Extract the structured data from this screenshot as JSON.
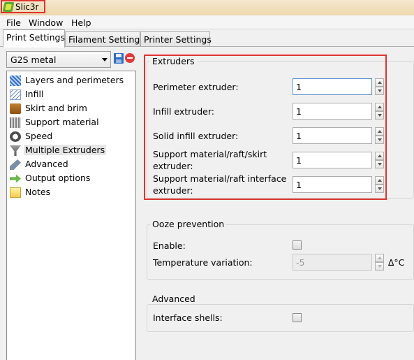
{
  "window": {
    "title": "Slic3r"
  },
  "menu": {
    "items": [
      "File",
      "Window",
      "Help"
    ]
  },
  "tabs": [
    {
      "label": "Print Settings",
      "active": true
    },
    {
      "label": "Filament Settings",
      "active": false
    },
    {
      "label": "Printer Settings",
      "active": false
    }
  ],
  "preset": {
    "selected": "G2S metal"
  },
  "sidebar": {
    "items": [
      {
        "label": "Layers and perimeters",
        "icon": "layers-icon"
      },
      {
        "label": "Infill",
        "icon": "infill-icon"
      },
      {
        "label": "Skirt and brim",
        "icon": "skirt-icon"
      },
      {
        "label": "Support material",
        "icon": "support-icon"
      },
      {
        "label": "Speed",
        "icon": "speed-icon"
      },
      {
        "label": "Multiple Extruders",
        "icon": "extruder-icon",
        "selected": true
      },
      {
        "label": "Advanced",
        "icon": "wrench-icon"
      },
      {
        "label": "Output options",
        "icon": "output-icon"
      },
      {
        "label": "Notes",
        "icon": "notes-icon"
      }
    ]
  },
  "extruders": {
    "title": "Extruders",
    "fields": [
      {
        "label": "Perimeter extruder:",
        "value": "1"
      },
      {
        "label": "Infill extruder:",
        "value": "1"
      },
      {
        "label": "Solid infill extruder:",
        "value": "1"
      },
      {
        "label_line1": "Support material/raft/skirt",
        "label_line2": "extruder:",
        "value": "1"
      },
      {
        "label_line1": "Support material/raft interface",
        "label_line2": "extruder:",
        "value": "1"
      }
    ]
  },
  "ooze": {
    "title": "Ooze prevention",
    "enable_label": "Enable:",
    "enable_checked": false,
    "temp_label": "Temperature variation:",
    "temp_value": "-5",
    "temp_unit": "∆°C"
  },
  "advanced": {
    "title": "Advanced",
    "interface_label": "Interface shells:",
    "interface_checked": false
  },
  "colors": {
    "highlight": "#e0342f",
    "titlebar": "#ecd7ae",
    "selection": "#e6e6e6"
  }
}
